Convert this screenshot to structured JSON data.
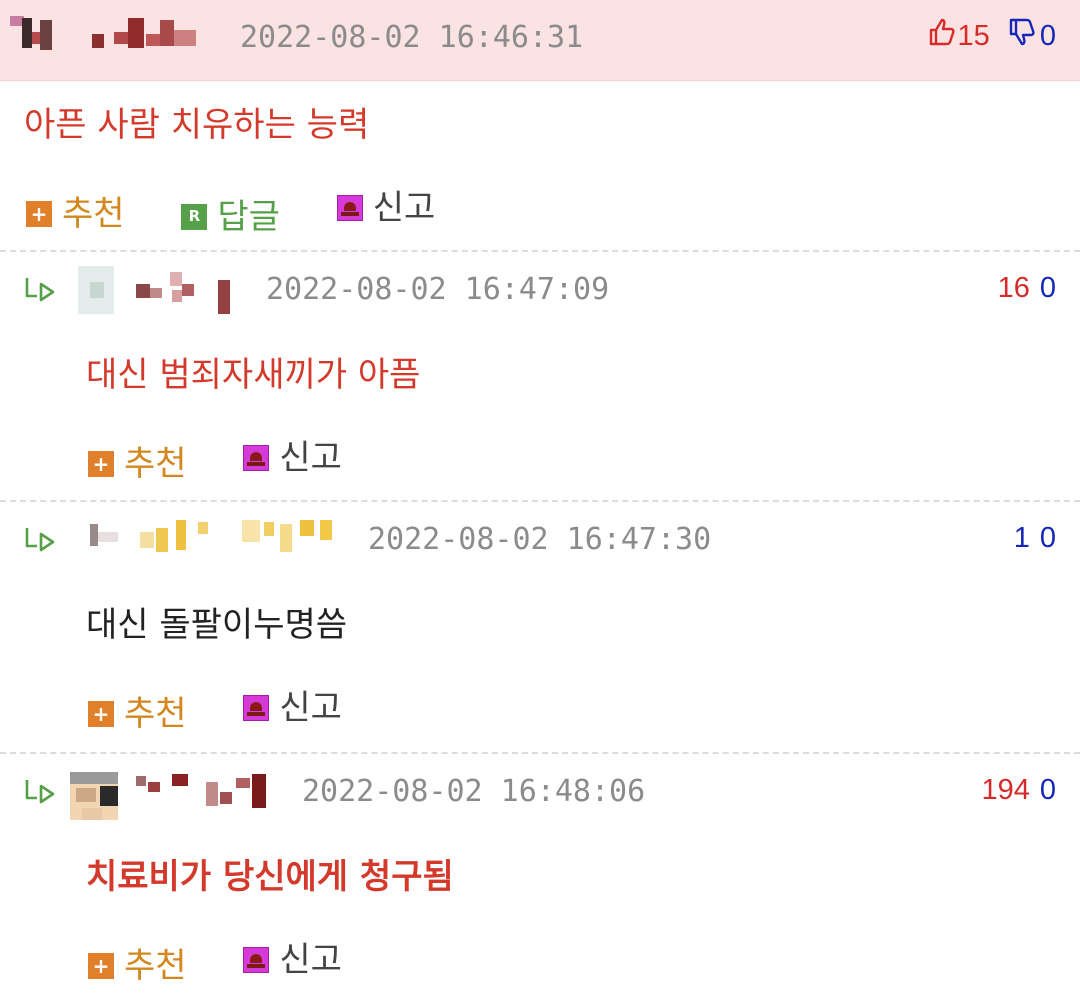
{
  "comments": [
    {
      "author_blurred": true,
      "timestamp": "2022-08-02 16:46:31",
      "upvotes": "15",
      "downvotes": "0",
      "text": "아픈 사람 치유하는 능력",
      "text_color": "#d33a2c",
      "text_bold": false,
      "actions": {
        "recommend": "추천",
        "reply": "답글",
        "report": "신고"
      }
    },
    {
      "author_blurred": true,
      "timestamp": "2022-08-02 16:47:09",
      "upvotes": "16",
      "downvotes": "0",
      "text": "대신 범죄자새끼가 아픔",
      "text_color": "#d33a2c",
      "text_bold": false,
      "actions": {
        "recommend": "추천",
        "report": "신고"
      }
    },
    {
      "author_blurred": true,
      "timestamp": "2022-08-02 16:47:30",
      "upvotes": "1",
      "downvotes": "0",
      "text": "대신 돌팔이누명씀",
      "text_color": "#222222",
      "text_bold": false,
      "actions": {
        "recommend": "추천",
        "report": "신고"
      }
    },
    {
      "author_blurred": true,
      "timestamp": "2022-08-02 16:48:06",
      "upvotes": "194",
      "downvotes": "0",
      "text": "치료비가 당신에게 청구됨",
      "text_color": "#d33a2c",
      "text_bold": true,
      "actions": {
        "recommend": "추천",
        "report": "신고"
      }
    }
  ],
  "colors": {
    "upvote": "#d72b2b",
    "downvote": "#1526b8",
    "recommend": "#d2871f",
    "reply": "#56a04a",
    "top_header_bg": "#fbe3e3"
  },
  "icons": [
    "thumbs-up-icon",
    "thumbs-down-icon",
    "reply-arrow-icon",
    "plus-icon",
    "reply-icon",
    "report-alarm-icon"
  ]
}
